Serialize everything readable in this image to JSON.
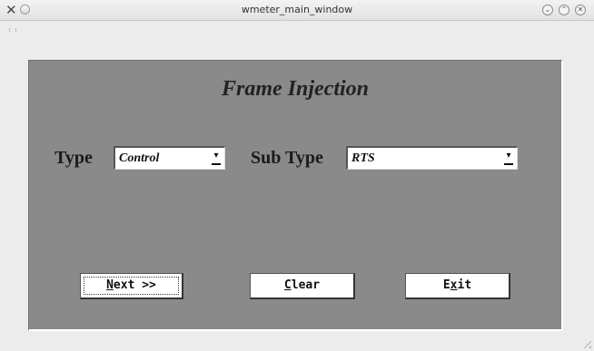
{
  "window": {
    "title": "wmeter_main_window"
  },
  "panel": {
    "heading": "Frame Injection",
    "type_label": "Type",
    "type_value": "Control",
    "subtype_label": "Sub Type",
    "subtype_value": "RTS"
  },
  "buttons": {
    "next": {
      "pre": "",
      "mnemonic": "N",
      "post": "ext >>"
    },
    "clear": {
      "pre": "",
      "mnemonic": "C",
      "post": "lear"
    },
    "exit": {
      "pre": "E",
      "mnemonic": "x",
      "post": "it"
    }
  },
  "icons": {
    "app": "x-logo-icon",
    "menu": "circle-menu-icon",
    "minimize": "chevron-down-icon",
    "maximize": "chevron-up-icon",
    "close": "close-icon",
    "dropdown": "dropdown-arrow-icon"
  }
}
